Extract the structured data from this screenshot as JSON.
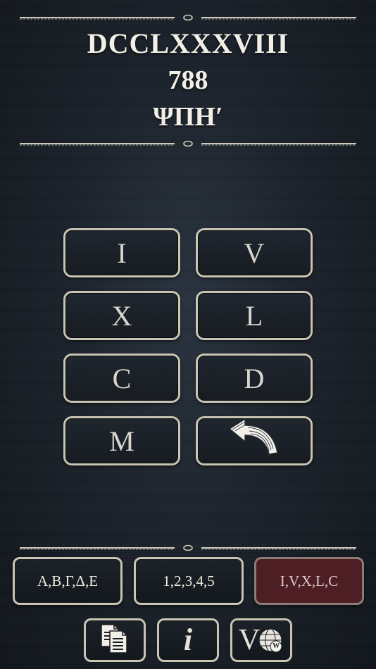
{
  "display": {
    "roman": "DCCLXXXVIII",
    "arabic": "788",
    "greek": "ΨΠΗʹ"
  },
  "keypad": {
    "keys": [
      "I",
      "V",
      "X",
      "L",
      "C",
      "D",
      "M"
    ],
    "backspace_icon": "backspace-arrow-icon"
  },
  "modes": {
    "greek": "Α,Β,Γ,Δ,Ε",
    "arabic": "1,2,3,4,5",
    "roman": "I,V,X,L,C",
    "active": "roman"
  },
  "toolbar": {
    "copy_icon": "copy-icon",
    "info_label": "i",
    "wiki_label": "V",
    "wiki_badge": "W"
  },
  "colors": {
    "background": "#1c232c",
    "border": "#c9c4b3",
    "active_mode": "#4d1f25"
  }
}
